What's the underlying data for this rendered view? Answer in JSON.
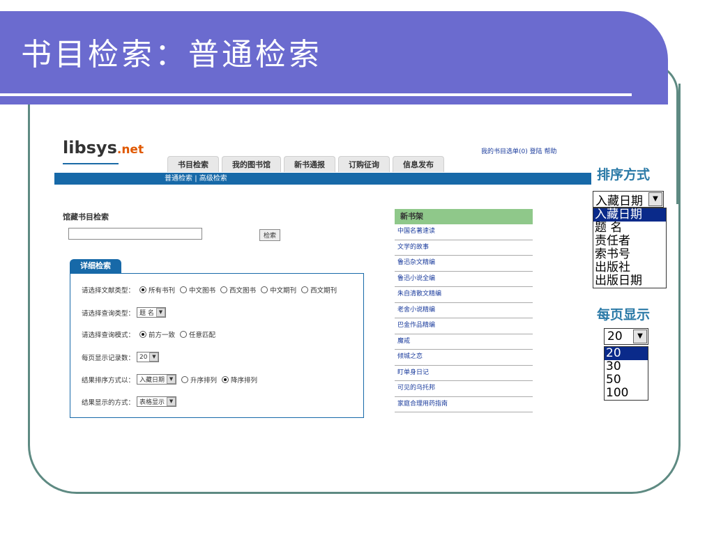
{
  "slide": {
    "title": "书目检索：普通检索"
  },
  "header": {
    "logo": "libsys",
    "logo_suffix": ".net",
    "toplinks": "我的书目选单(0)  登陆  帮助",
    "tabs": [
      "书目检索",
      "我的图书馆",
      "新书通报",
      "订购征询",
      "信息发布"
    ],
    "subnav": [
      "普通检索",
      "|",
      "高级检索"
    ]
  },
  "search": {
    "section_title": "馆藏书目检索",
    "input_value": "",
    "button_label": "检索"
  },
  "advanced": {
    "tab_label": "详细检索",
    "doc_type_label": "请选择文献类型：",
    "doc_types": [
      "所有书刊",
      "中文图书",
      "西文图书",
      "中文期刊",
      "西文期刊"
    ],
    "query_type_label": "请选择查询类型：",
    "query_type_value": "题 名",
    "mode_label": "请选择查询模式：",
    "modes": [
      "前方一致",
      "任意匹配"
    ],
    "per_page_label": "每页显示记录数：",
    "per_page_value": "20",
    "sort_label": "结果排序方式以：",
    "sort_value": "入藏日期",
    "sort_orders": [
      "升序排列",
      "降序排列"
    ],
    "display_label": "结果显示的方式：",
    "display_value": "表格显示"
  },
  "newbooks": {
    "title": "新书架",
    "items": [
      "中国名著速读",
      "文学的故事",
      "鲁迅杂文精编",
      "鲁迅小说全编",
      "朱自清散文精编",
      "老舍小说精编",
      "巴金作品精编",
      "魔戒",
      "倾城之恋",
      "盯单身日记",
      "可见的乌托邦",
      "家庭合理用药指南"
    ]
  },
  "sort_panel": {
    "heading": "排序方式",
    "selected": "入藏日期",
    "options": [
      "入藏日期",
      "题   名",
      "责任者",
      "索书号",
      "出版社",
      "出版日期"
    ]
  },
  "perpage_panel": {
    "heading": "每页显示",
    "selected": "20",
    "options": [
      "20",
      "30",
      "50",
      "100"
    ]
  }
}
